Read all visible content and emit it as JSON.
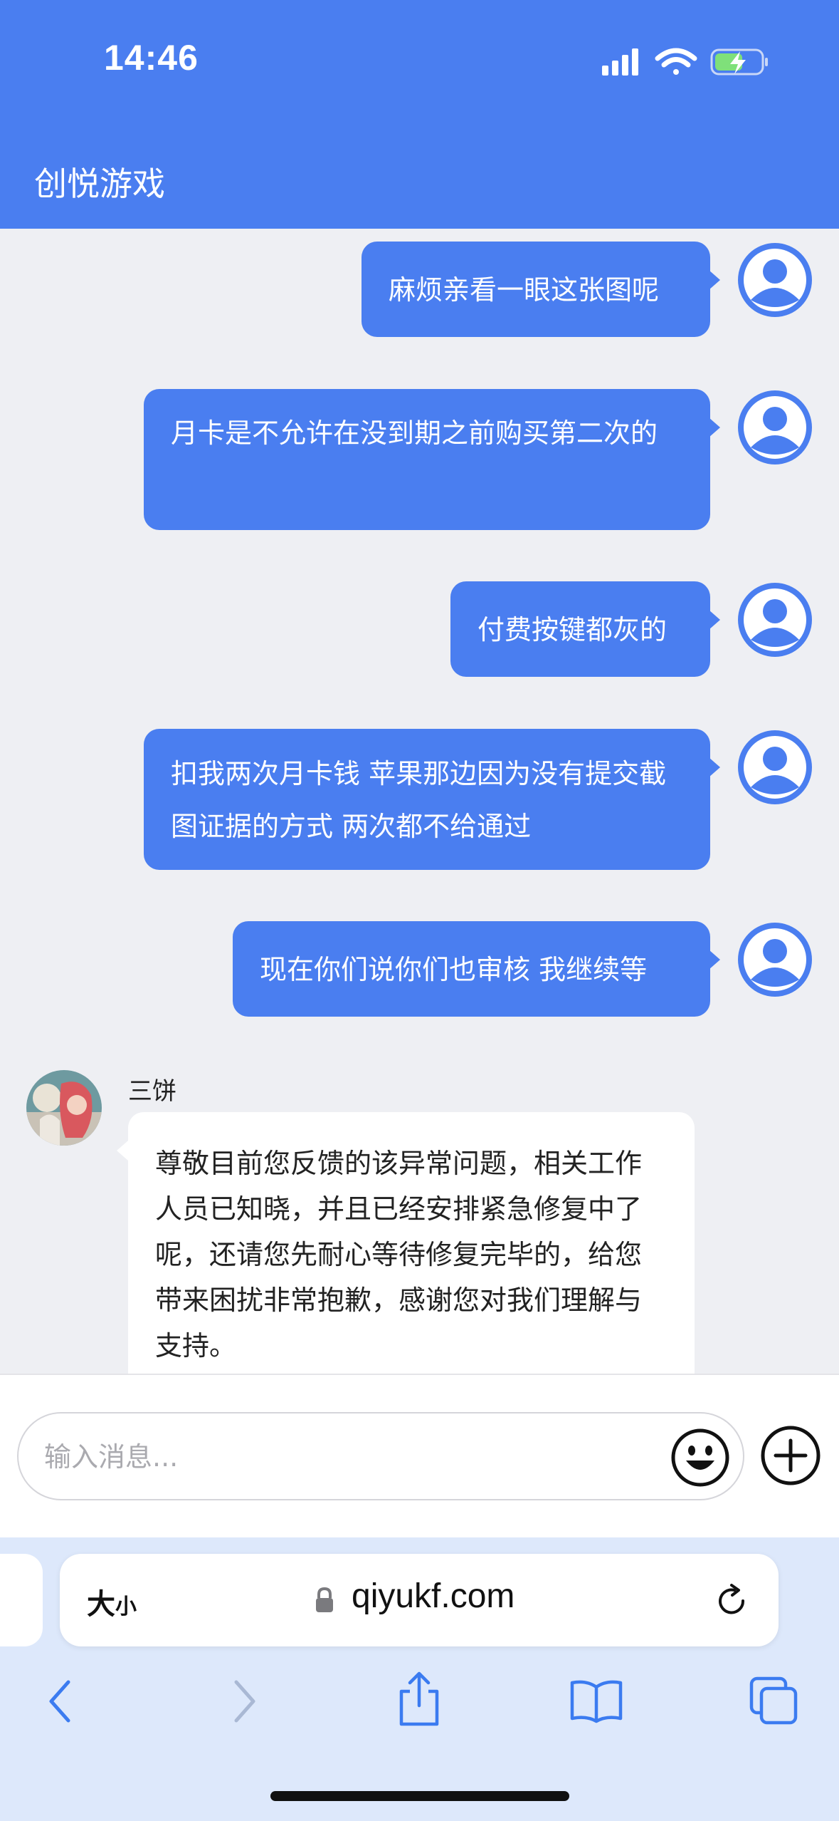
{
  "status_bar": {
    "time": "14:46"
  },
  "header": {
    "title": "创悦游戏"
  },
  "messages": [
    {
      "side": "out",
      "text": "麻烦亲看一眼这张图呢"
    },
    {
      "side": "out",
      "text": "月卡是不允许在没到期之前购买第二次的"
    },
    {
      "side": "out",
      "text": "付费按键都灰的"
    },
    {
      "side": "out",
      "text": "扣我两次月卡钱 苹果那边因为没有提交截图证据的方式 两次都不给通过"
    },
    {
      "side": "out",
      "text": "现在你们说你们也审核 我继续等"
    },
    {
      "side": "in",
      "sender": "三饼",
      "text": "尊敬目前您反馈的该异常问题，相关工作人员已知晓，并且已经安排紧急修复中了呢，还请您先耐心等待修复完毕的，给您带来困扰非常抱歉，感谢您对我们理解与支持。"
    }
  ],
  "composer": {
    "placeholder": "输入消息..."
  },
  "browser": {
    "text_size_label": "大",
    "text_size_small": "小",
    "url": "qiyukf.com"
  },
  "colors": {
    "accent": "#4a7ef0",
    "chat_bg": "#eeeff3",
    "browser_bg": "#dde8fb"
  }
}
